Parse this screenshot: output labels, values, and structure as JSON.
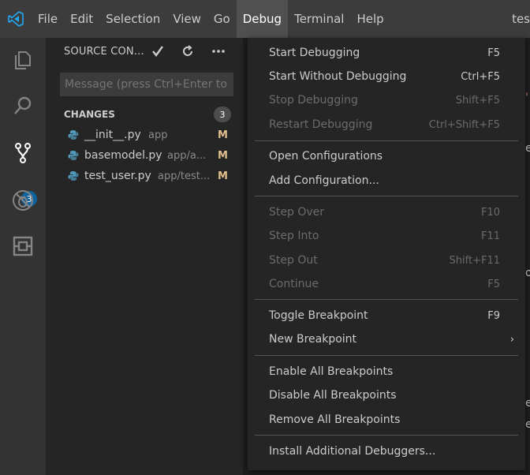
{
  "menubar": {
    "logo": "vscode-logo",
    "items": [
      "File",
      "Edit",
      "Selection",
      "View",
      "Go",
      "Debug",
      "Terminal",
      "Help"
    ],
    "active": "Debug",
    "window_title": "tes"
  },
  "activity_bar": {
    "scm_badge": "3"
  },
  "sidebar": {
    "title": "SOURCE CON...",
    "commit_placeholder": "Message (press Ctrl+Enter to",
    "changes_label": "CHANGES",
    "changes_count": "3",
    "files": [
      {
        "name": "__init__.py",
        "path": "app",
        "status": "M"
      },
      {
        "name": "basemodel.py",
        "path": "app/a...",
        "status": "M"
      },
      {
        "name": "test_user.py",
        "path": "app/test...",
        "status": "M"
      }
    ]
  },
  "debug_menu": {
    "items": [
      {
        "label": "Start Debugging",
        "key": "F5"
      },
      {
        "label": "Start Without Debugging",
        "key": "Ctrl+F5"
      },
      {
        "label": "Stop Debugging",
        "key": "Shift+F5"
      },
      {
        "label": "Restart Debugging",
        "key": "Ctrl+Shift+F5"
      },
      {
        "label": "Open Configurations",
        "key": ""
      },
      {
        "label": "Add Configuration...",
        "key": ""
      },
      {
        "label": "Step Over",
        "key": "F10"
      },
      {
        "label": "Step Into",
        "key": "F11"
      },
      {
        "label": "Step Out",
        "key": "Shift+F11"
      },
      {
        "label": "Continue",
        "key": "F5"
      },
      {
        "label": "Toggle Breakpoint",
        "key": "F9"
      },
      {
        "label": "New Breakpoint",
        "key": ""
      },
      {
        "label": "Enable All Breakpoints",
        "key": ""
      },
      {
        "label": "Disable All Breakpoints",
        "key": ""
      },
      {
        "label": "Remove All Breakpoints",
        "key": ""
      },
      {
        "label": "Install Additional Debuggers...",
        "key": ""
      }
    ]
  },
  "colors": {
    "accent": "#0e639c",
    "modified": "#e2c08d",
    "logo": "#23a9f2"
  }
}
